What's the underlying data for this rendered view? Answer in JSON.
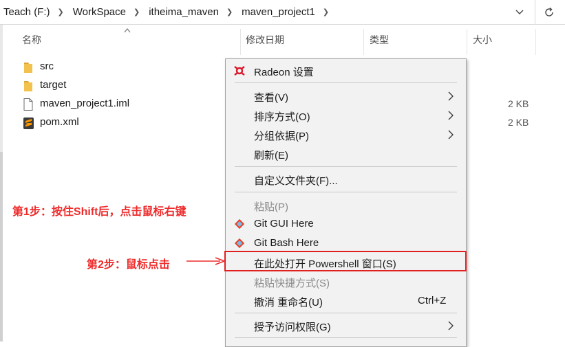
{
  "address_bar": {
    "crumbs": [
      "Teach (F:)",
      "WorkSpace",
      "itheima_maven",
      "maven_project1"
    ]
  },
  "columns": {
    "name": "名称",
    "date": "修改日期",
    "type": "类型",
    "size": "大小"
  },
  "files": [
    {
      "name": "src",
      "size": "",
      "icon": "folder-icon"
    },
    {
      "name": "target",
      "size": "",
      "icon": "folder-icon"
    },
    {
      "name": "maven_project1.iml",
      "size": "2 KB",
      "icon": "file-icon"
    },
    {
      "name": "pom.xml",
      "size": "2 KB",
      "icon": "sublime-text-icon"
    }
  ],
  "context_menu": {
    "radeon": "Radeon 设置",
    "view": "查看(V)",
    "sort": "排序方式(O)",
    "group": "分组依据(P)",
    "refresh": "刷新(E)",
    "customize": "自定义文件夹(F)...",
    "paste": "粘贴(P)",
    "git_gui": "Git GUI Here",
    "git_bash": "Git Bash Here",
    "powershell": "在此处打开 Powershell 窗口(S)",
    "paste_shortcut": "粘贴快捷方式(S)",
    "undo_rename": "撤消 重命名(U)",
    "undo_shortcut": "Ctrl+Z",
    "grant_access": "授予访问权限(G)"
  },
  "annotations": {
    "step1": "第1步：按住Shift后，点击鼠标右键",
    "step2": "第2步：鼠标点击"
  },
  "colors": {
    "annotation_red": "#ee2b2b",
    "folder_yellow": "#f2c14e",
    "menu_bg": "#f2f2f2"
  }
}
